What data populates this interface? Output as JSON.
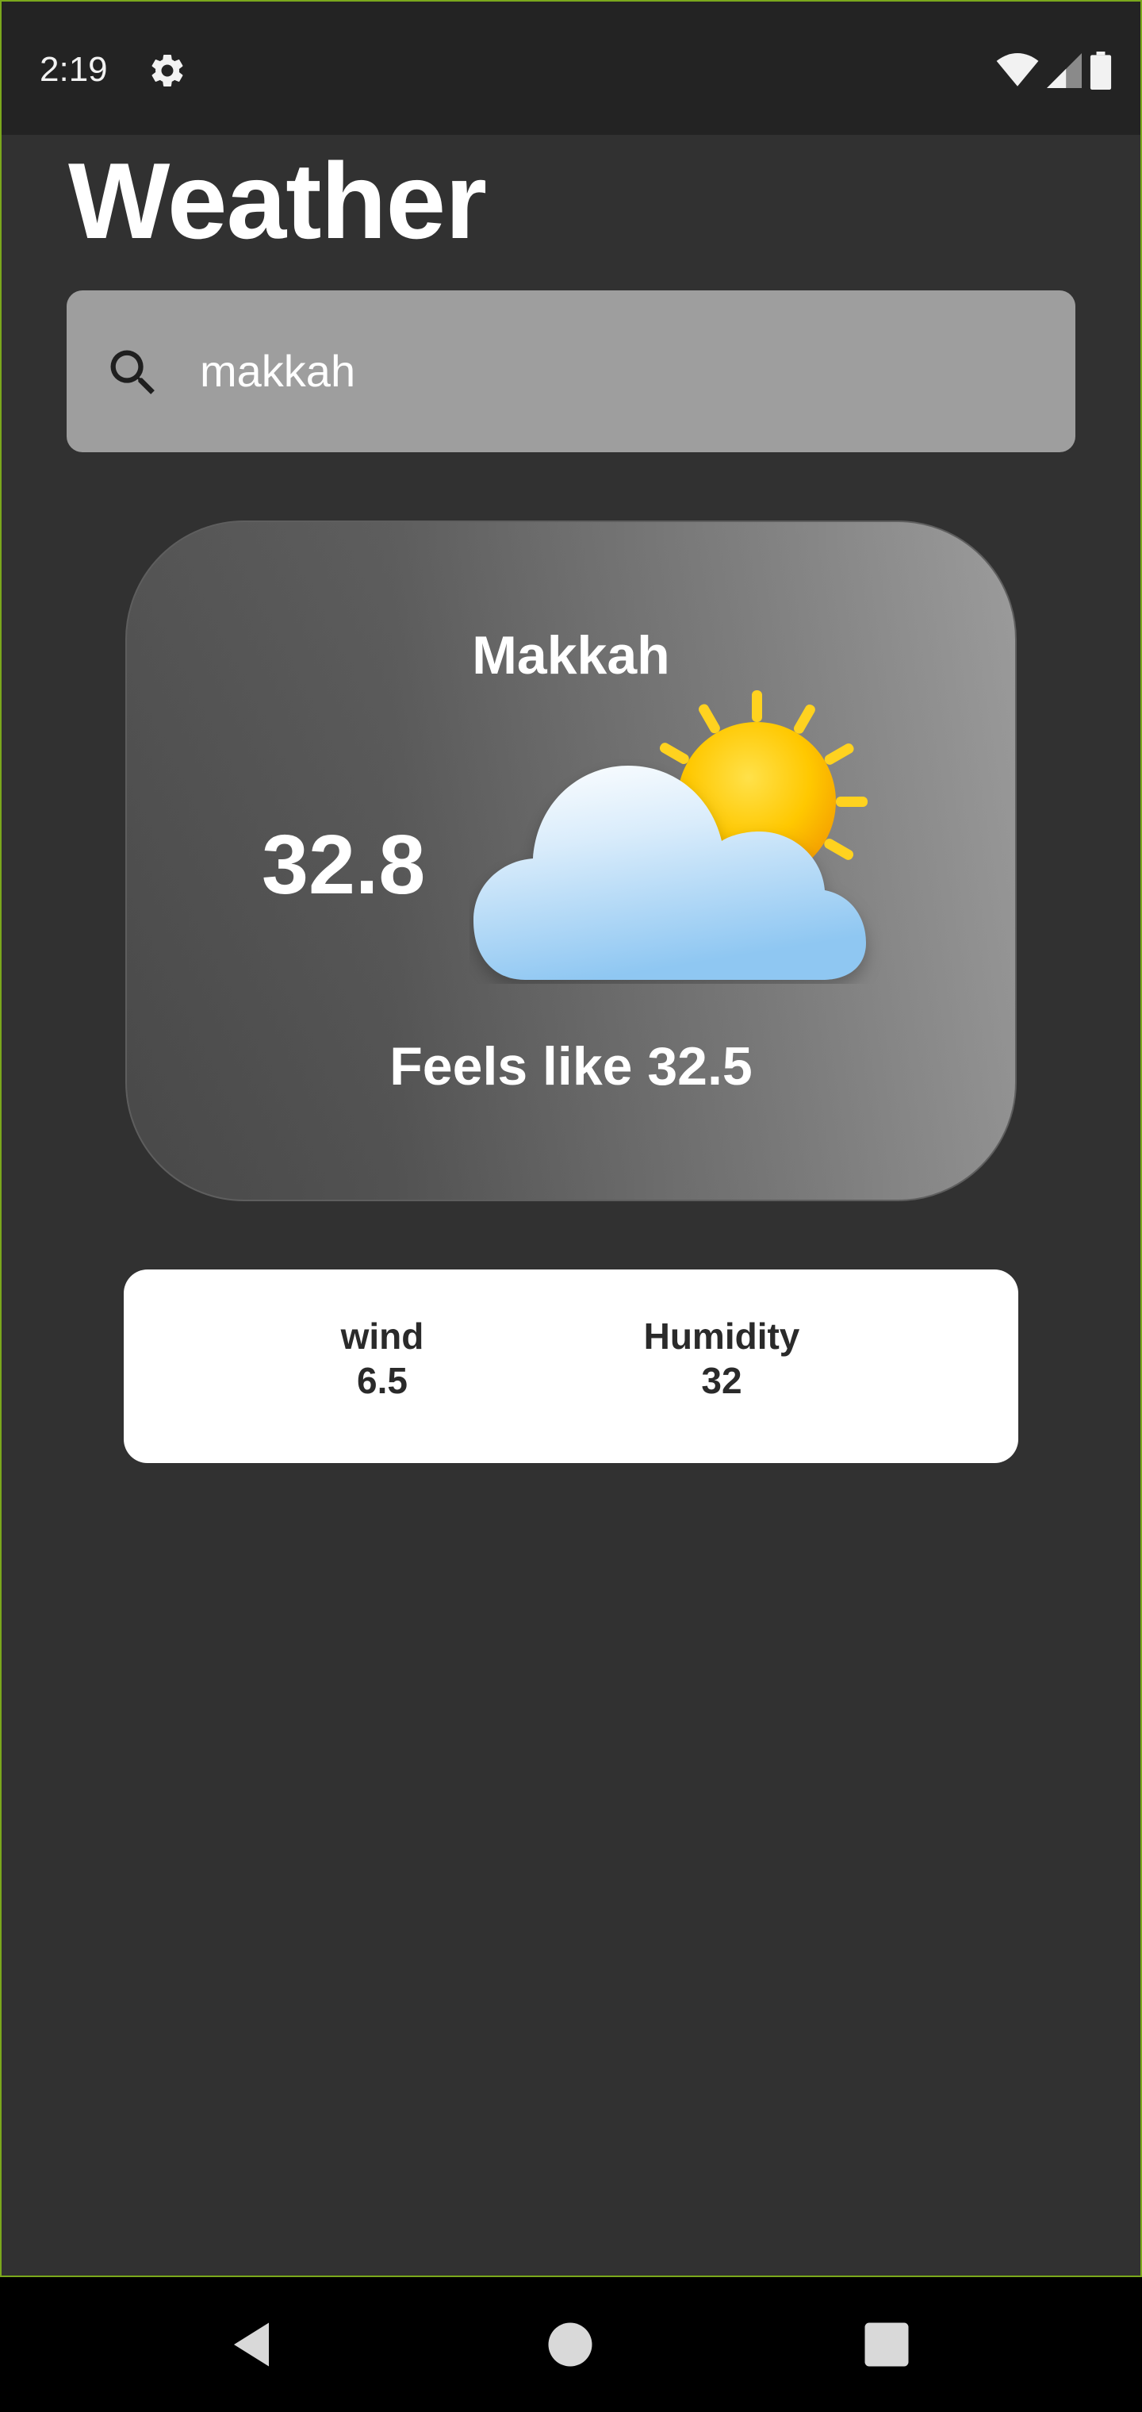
{
  "status_bar": {
    "time": "2:19",
    "icons": [
      "settings-gear-icon",
      "wifi-icon",
      "cell-signal-icon",
      "battery-icon"
    ]
  },
  "app": {
    "title": "Weather"
  },
  "search": {
    "value": "makkah",
    "placeholder": ""
  },
  "weather": {
    "city": "Makkah",
    "temperature": "32.8",
    "feels_like": "Feels like 32.5",
    "condition_icon": "partly-cloudy-icon"
  },
  "details": {
    "wind_label": "wind",
    "wind_value": "6.5",
    "humidity_label": "Humidity",
    "humidity_value": "32"
  },
  "nav_bar": {
    "icons": [
      "back-icon",
      "home-icon",
      "recents-icon"
    ]
  },
  "colors": {
    "background": "#313131",
    "status_bar": "#232323",
    "search_box": "#9e9e9e",
    "details_card": "#ffffff",
    "frame_border": "#7aa81c"
  }
}
